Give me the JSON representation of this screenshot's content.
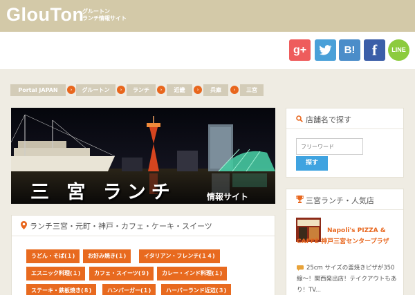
{
  "header": {
    "logo": "GlouTon",
    "subtitle_line1": "グルートン",
    "subtitle_line2": "ランチ情報サイト"
  },
  "social": [
    {
      "name": "google-plus",
      "label": "g+",
      "color": "#ee5c5c"
    },
    {
      "name": "twitter",
      "label": "",
      "color": "#4aa0d8"
    },
    {
      "name": "hatena-bookmark",
      "label": "B!",
      "color": "#4b8dc9"
    },
    {
      "name": "facebook",
      "label": "f",
      "color": "#3b5ea8"
    },
    {
      "name": "line",
      "label": "LINE",
      "color": "#8ccb3e"
    }
  ],
  "breadcrumb": [
    "Portal JAPAN",
    "グルートン",
    "ランチ",
    "近畿",
    "兵庫",
    "三宮"
  ],
  "banner": {
    "title": "三 宮 ランチ",
    "suffix": "情報サイト"
  },
  "category_panel": {
    "title": "ランチ三宮・元町・神戸・カフェ・ケーキ・スイーツ",
    "tags": [
      "うどん・そば(１)",
      "お好み焼き(１)",
      "イタリアン・フレンチ(１４)",
      "エスニック料理(１)",
      "カフェ・スイーツ(９)",
      "カレー・インド料理(１)",
      "ステーキ・鉄板焼き(８)",
      "ハンバーガー(１)",
      "ハーバーランド近辺(３)"
    ]
  },
  "search_box": {
    "title": "店舗名で探す",
    "placeholder": "フリーワード",
    "button": "探す"
  },
  "ranking": {
    "title": "三宮ランチ・人気店",
    "item_title": "Napoli's PIZZA & CAFFÈ 神戸三宮センタープラザ",
    "item_desc": "25cm サイズの釜焼きピザが350線〜！関西発出店！テイクアウトもあり！TV..."
  }
}
